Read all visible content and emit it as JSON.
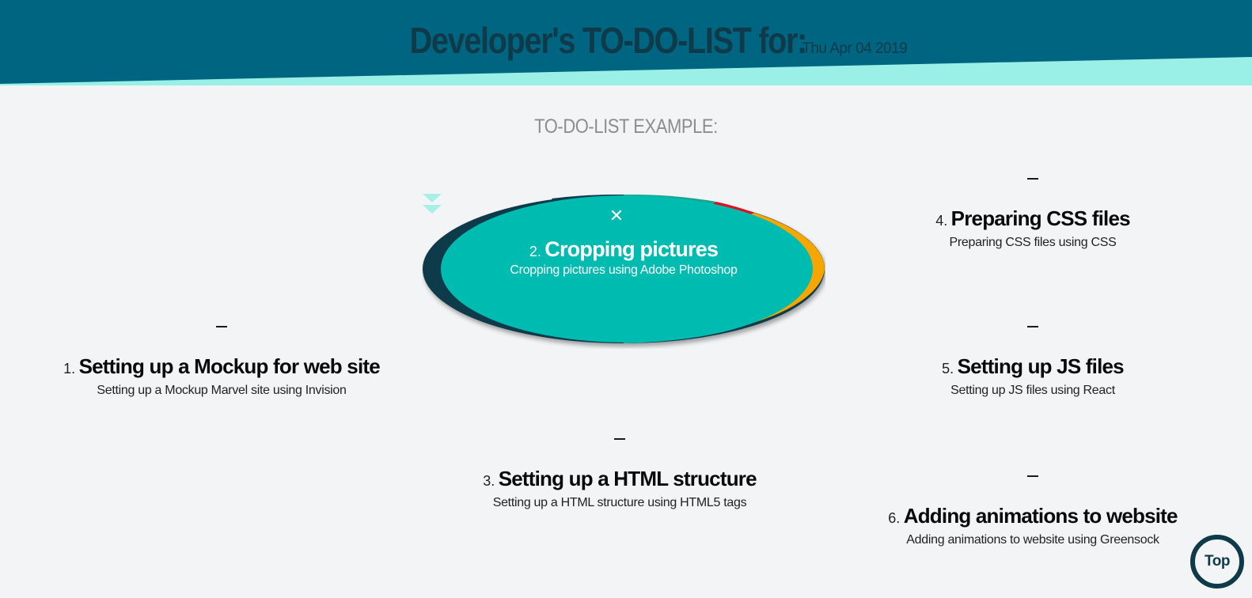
{
  "header": {
    "title": "Developer's TO-DO-LIST for:",
    "date": "Thu Apr 04 2019",
    "colors": {
      "dark_band": "#006580",
      "light_band": "#9aefe6",
      "title_text": "#0e3a4a"
    }
  },
  "section_title": "TO-DO-LIST EXAMPLE:",
  "tasks": [
    {
      "number": "1.",
      "title": "Setting up a Mockup for web site",
      "description": "Setting up a Mockup Marvel site using Invision"
    },
    {
      "number": "2.",
      "title": "Cropping pictures",
      "description": "Cropping pictures using Adobe Photoshop"
    },
    {
      "number": "3.",
      "title": "Setting up a HTML structure",
      "description": "Setting up a HTML structure using HTML5 tags"
    },
    {
      "number": "4.",
      "title": "Preparing CSS files",
      "description": "Preparing CSS files using CSS"
    },
    {
      "number": "5.",
      "title": "Setting up JS files",
      "description": "Setting up JS files using React"
    },
    {
      "number": "6.",
      "title": "Adding animations to website",
      "description": "Adding animations to website using Greensock"
    }
  ],
  "active_task": {
    "close_icon": "close-icon",
    "expand_icon": "double-chevron-down-icon",
    "colors": {
      "fill": "#00bbb0",
      "ring_dark": "#0e3a4a",
      "ring_green": "#17a68a",
      "ring_red": "#e0101e",
      "ring_orange": "#f7a600"
    }
  },
  "top_button": {
    "label": "Top"
  }
}
